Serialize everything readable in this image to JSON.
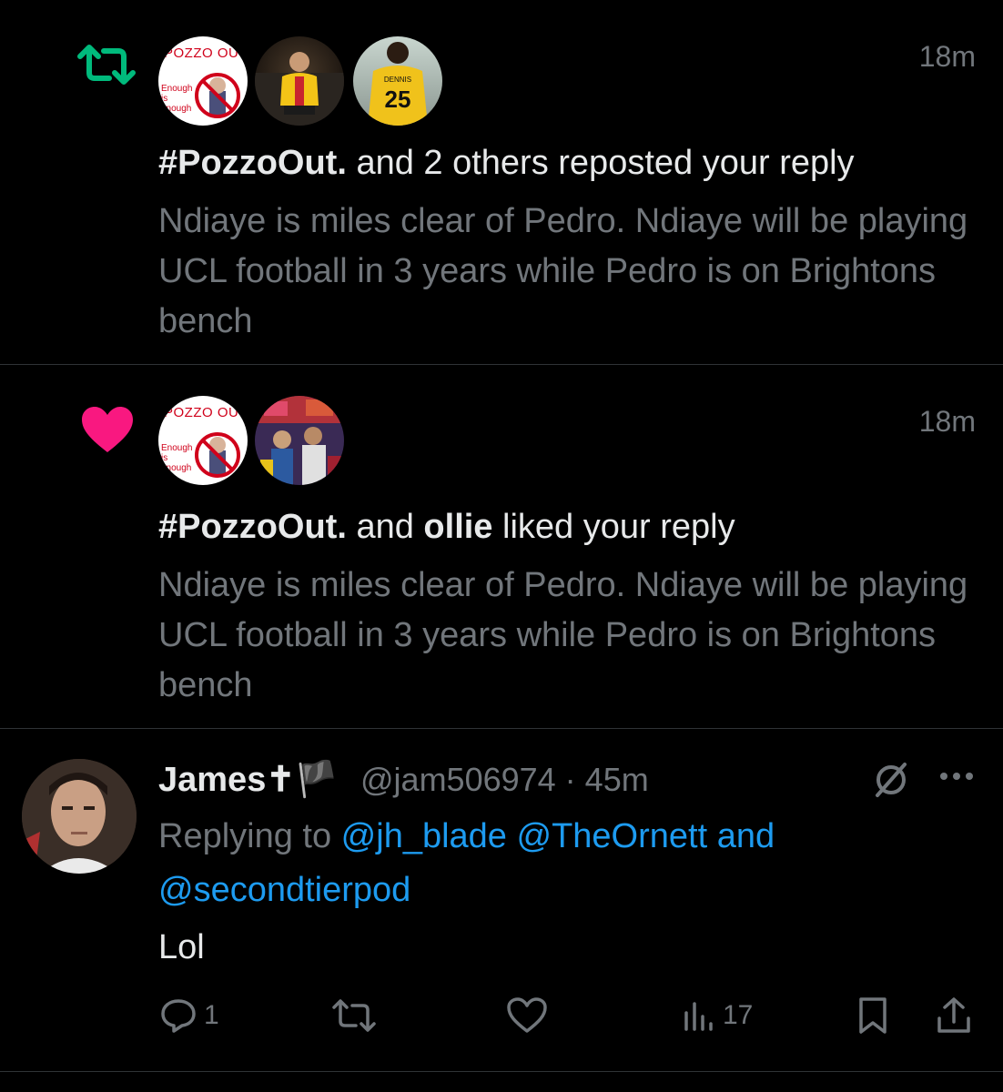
{
  "notifications": [
    {
      "type": "repost",
      "icon": "repost-icon",
      "icon_color": "#00ba7c",
      "time": "18m",
      "avatars": [
        "pozzo-out-avatar",
        "yellow-shirt-avatar",
        "dennis-25-avatar"
      ],
      "actor": "#PozzoOut.",
      "rest": " and 2 others reposted your reply",
      "quote": "Ndiaye is miles clear of Pedro. Ndiaye will be playing UCL football in 3 years while Pedro is on Brightons bench"
    },
    {
      "type": "like",
      "icon": "heart-icon",
      "icon_color": "#f91880",
      "time": "18m",
      "avatars": [
        "pozzo-out-avatar",
        "crowd-avatar"
      ],
      "actor": "#PozzoOut.",
      "middle": " and ",
      "actor2": "ollie",
      "rest": " liked your reply",
      "quote": "Ndiaye is miles clear of Pedro. Ndiaye will be playing UCL football in 3 years while Pedro is on Brightons bench"
    }
  ],
  "pozzo_avatar": {
    "line1": "POZZO OUT",
    "line2": "Enough is enough"
  },
  "tweet": {
    "name": "James✝🏴",
    "handle_time": "@jam506974 · 45m",
    "replying_prefix": "Replying to ",
    "mentions": "@jh_blade @TheOrnett and @secondtierpod",
    "text": "Lol",
    "actions": {
      "reply_count": "1",
      "repost_count": "",
      "like_count": "",
      "views_count": "17"
    },
    "accent_color": "#1d9bf0"
  }
}
